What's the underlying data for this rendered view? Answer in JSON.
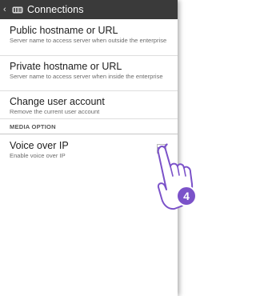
{
  "topbar": {
    "back_glyph": "‹",
    "title": "Connections",
    "app_icon": "connections-app-icon"
  },
  "prefs": [
    {
      "title": "Public hostname or URL",
      "summary": "Server name to access server when outside the enterprise"
    },
    {
      "title": "Private hostname or URL",
      "summary": "Server name to access server when inside the enterprise"
    },
    {
      "title": "Change user account",
      "summary": "Remove the current user account"
    }
  ],
  "media_section": {
    "header": "MEDIA OPTION",
    "voip": {
      "title": "Voice over IP",
      "summary": "Enable voice over IP",
      "checked": true
    }
  },
  "overlay": {
    "step_number": "4",
    "hand_icon": "tap-hand-icon",
    "badge_color": "#7b52c9"
  },
  "colors": {
    "topbar": "#3a3a3a",
    "checkbox_accent": "#7b52c9"
  }
}
